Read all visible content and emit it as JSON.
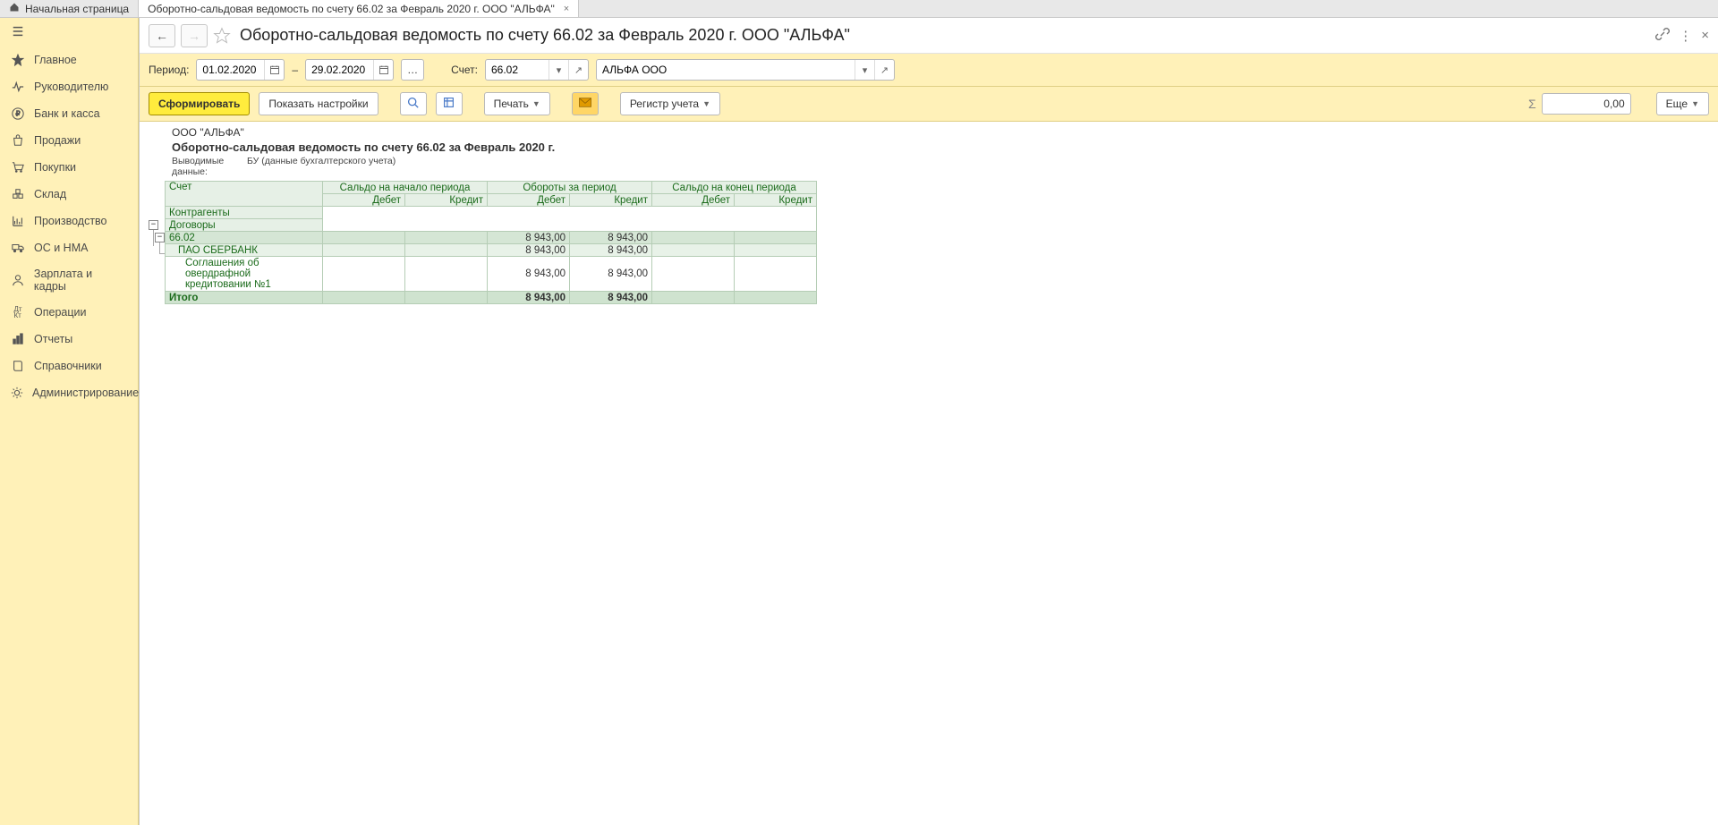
{
  "tabs": {
    "home": "Начальная страница",
    "doc": "Оборотно-сальдовая ведомость по счету 66.02 за Февраль 2020 г. ООО \"АЛЬФА\""
  },
  "sidebar": {
    "items": [
      {
        "label": "Главное",
        "icon": "star"
      },
      {
        "label": "Руководителю",
        "icon": "pulse"
      },
      {
        "label": "Банк и касса",
        "icon": "ruble"
      },
      {
        "label": "Продажи",
        "icon": "bag"
      },
      {
        "label": "Покупки",
        "icon": "cart"
      },
      {
        "label": "Склад",
        "icon": "boxes"
      },
      {
        "label": "Производство",
        "icon": "chart"
      },
      {
        "label": "ОС и НМА",
        "icon": "truck"
      },
      {
        "label": "Зарплата и кадры",
        "icon": "person"
      },
      {
        "label": "Операции",
        "icon": "dtkt"
      },
      {
        "label": "Отчеты",
        "icon": "bars"
      },
      {
        "label": "Справочники",
        "icon": "book"
      },
      {
        "label": "Администрирование",
        "icon": "gear"
      }
    ]
  },
  "title": "Оборотно-сальдовая ведомость по счету 66.02 за Февраль 2020 г. ООО \"АЛЬФА\"",
  "params": {
    "period_label": "Период:",
    "date_from": "01.02.2020",
    "dash": "–",
    "date_to": "29.02.2020",
    "account_label": "Счет:",
    "account": "66.02",
    "org": "АЛЬФА ООО"
  },
  "toolbar": {
    "generate": "Сформировать",
    "show_settings": "Показать настройки",
    "print": "Печать",
    "register": "Регистр учета",
    "more": "Еще",
    "sum": "0,00"
  },
  "report": {
    "org": "ООО \"АЛЬФА\"",
    "title": "Оборотно-сальдовая ведомость по счету 66.02 за Февраль 2020 г.",
    "meta_label": "Выводимые данные:",
    "meta_value": "БУ (данные бухгалтерского учета)",
    "headers": {
      "col0_lines": [
        "Счет",
        "Контрагенты",
        "Договоры"
      ],
      "grp1": "Сальдо на начало периода",
      "grp2": "Обороты за период",
      "grp3": "Сальдо на конец периода",
      "debit": "Дебет",
      "credit": "Кредит"
    },
    "rows": [
      {
        "level": 0,
        "name": "66.02",
        "ob_dt": "8 943,00",
        "ob_kt": "8 943,00"
      },
      {
        "level": 1,
        "name": "ПАО СБЕРБАНК",
        "ob_dt": "8 943,00",
        "ob_kt": "8 943,00"
      },
      {
        "level": 2,
        "name": "Соглашения об овердрафной кредитовании №1",
        "ob_dt": "8 943,00",
        "ob_kt": "8 943,00"
      }
    ],
    "total": {
      "name": "Итого",
      "ob_dt": "8 943,00",
      "ob_kt": "8 943,00"
    }
  },
  "chart_data": {
    "type": "table",
    "title": "Оборотно-сальдовая ведомость по счету 66.02 за Февраль 2020 г.",
    "columns": [
      "Счет / Контрагенты / Договоры",
      "Сальдо на начало периода — Дебет",
      "Сальдо на начало периода — Кредит",
      "Обороты за период — Дебет",
      "Обороты за период — Кредит",
      "Сальдо на конец периода — Дебет",
      "Сальдо на конец периода — Кредит"
    ],
    "rows": [
      [
        "66.02",
        null,
        null,
        8943.0,
        8943.0,
        null,
        null
      ],
      [
        "ПАО СБЕРБАНК",
        null,
        null,
        8943.0,
        8943.0,
        null,
        null
      ],
      [
        "Соглашения об овердрафной кредитовании №1",
        null,
        null,
        8943.0,
        8943.0,
        null,
        null
      ],
      [
        "Итого",
        null,
        null,
        8943.0,
        8943.0,
        null,
        null
      ]
    ]
  }
}
